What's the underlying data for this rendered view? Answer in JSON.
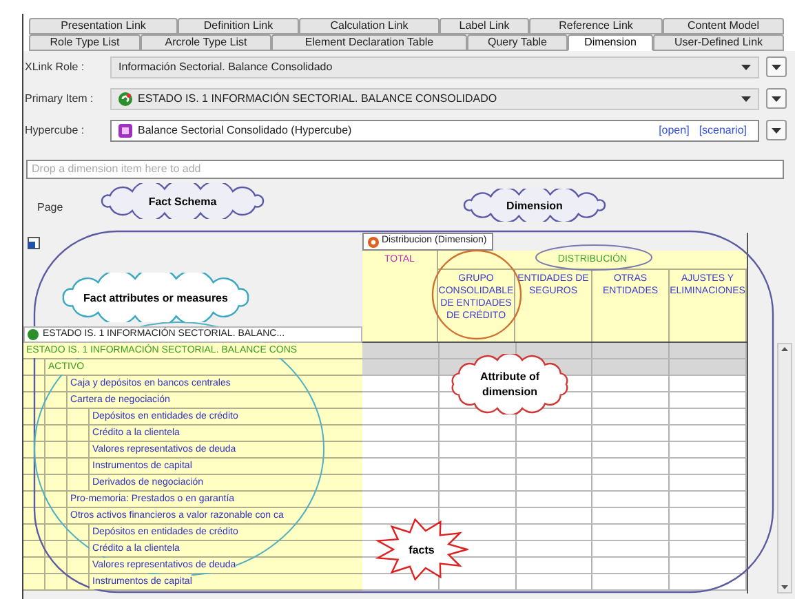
{
  "tabs_row_1": [
    {
      "label": "Presentation Link",
      "selected": false
    },
    {
      "label": "Definition Link",
      "selected": false
    },
    {
      "label": "Calculation Link",
      "selected": false
    },
    {
      "label": "Label Link",
      "selected": false
    },
    {
      "label": "Reference Link",
      "selected": false
    },
    {
      "label": "Content Model",
      "selected": false
    }
  ],
  "tabs_row_2": [
    {
      "label": "Role Type List",
      "selected": false
    },
    {
      "label": "Arcrole Type List",
      "selected": false
    },
    {
      "label": "Element Declaration Table",
      "selected": false
    },
    {
      "label": "Query Table",
      "selected": false
    },
    {
      "label": "Dimension",
      "selected": true
    },
    {
      "label": "User-Defined Link",
      "selected": false
    }
  ],
  "fields": [
    {
      "label": "XLink Role :",
      "value": "Información Sectorial. Balance Consolidado",
      "kind": "role"
    },
    {
      "label": "Primary Item :",
      "value": "ESTADO IS. 1 INFORMACIÓN SECTORIAL. BALANCE CONSOLIDADO",
      "kind": "primary"
    },
    {
      "label": "Hypercube :",
      "value": "Balance Sectorial Consolidado (Hypercube)",
      "kind": "hypercube",
      "links": [
        "[open]",
        "[scenario]"
      ]
    }
  ],
  "drop_zone": {
    "placeholder": "Drop a dimension item here to add"
  },
  "page_label": "Page",
  "grid": {
    "dimension": "Distribucion (Dimension)",
    "primary_item": "ESTADO IS. 1 INFORMACIÓN SECTORIAL. BALANC...",
    "total_column": "TOTAL",
    "group": "DISTRIBUCIÓN",
    "columns": [
      "GRUPO CONSOLIDABLE DE ENTIDADES DE CRÉDITO",
      "ENTIDADES DE SEGUROS",
      "OTRAS ENTIDADES",
      "AJUSTES Y ELIMINACIONES"
    ],
    "rows": [
      {
        "label": "ESTADO IS. 1 INFORMACIÓN SECTORIAL. BALANCE CONS",
        "abstract": true,
        "children": [
          {
            "label": "ACTIVO",
            "abstract": true,
            "children": [
              {
                "label": "Caja y depósitos en bancos centrales",
                "abstract": false
              },
              {
                "label": "Cartera de negociación",
                "abstract": false,
                "children": [
                  {
                    "label": "Depósitos en entidades de crédito",
                    "abstract": false
                  },
                  {
                    "label": "Crédito a la clientela",
                    "abstract": false
                  },
                  {
                    "label": "Valores representativos de deuda",
                    "abstract": false
                  },
                  {
                    "label": "Instrumentos de capital",
                    "abstract": false
                  },
                  {
                    "label": "Derivados de negociación",
                    "abstract": false
                  }
                ]
              },
              {
                "label": "Pro-memoria: Prestados o en garantía",
                "abstract": false
              },
              {
                "label": "Otros activos financieros a valor razonable con ca",
                "abstract": false,
                "children": [
                  {
                    "label": "Depósitos en entidades de crédito",
                    "abstract": false
                  },
                  {
                    "label": "Crédito a la clientela",
                    "abstract": false
                  },
                  {
                    "label": "Valores representativos de deuda",
                    "abstract": false
                  },
                  {
                    "label": "Instrumentos de capital",
                    "abstract": false
                  }
                ]
              }
            ]
          }
        ]
      }
    ]
  },
  "annotations": [
    {
      "kind": "cloud",
      "text": "Fact Schema",
      "color": "#5a5aa8"
    },
    {
      "kind": "cloud",
      "text": "Dimension",
      "color": "#5a5aa8"
    },
    {
      "kind": "cloud",
      "text": "Fact attributes or measures",
      "color": "#3aa8c0"
    },
    {
      "kind": "cloud",
      "text": "Attribute of dimension",
      "color": "#d03838"
    },
    {
      "kind": "starburst",
      "text": "facts",
      "color": "#e02020"
    }
  ]
}
